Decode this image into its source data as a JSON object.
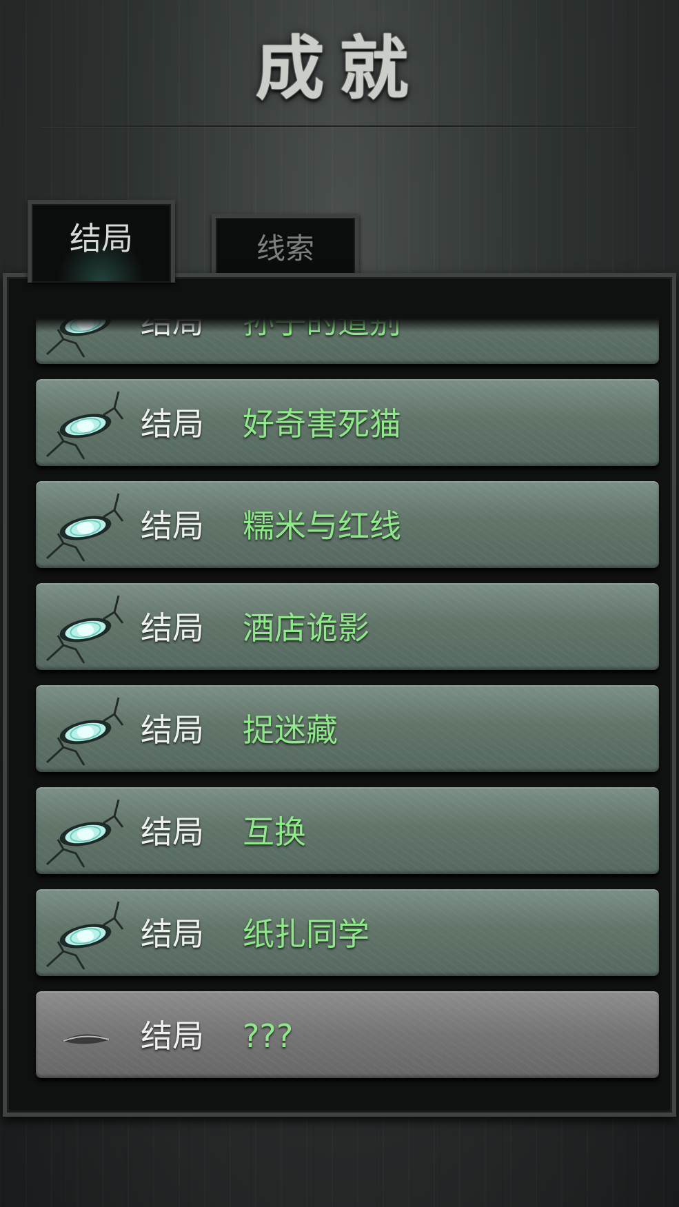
{
  "title": "成就",
  "tabs": [
    {
      "label": "结局",
      "active": true
    },
    {
      "label": "线索",
      "active": false
    }
  ],
  "list": {
    "rows": [
      {
        "label": "结局",
        "name": "孙子的道别",
        "unlocked": true,
        "icon": "cracked-eye-icon"
      },
      {
        "label": "结局",
        "name": "好奇害死猫",
        "unlocked": true,
        "icon": "cracked-eye-icon"
      },
      {
        "label": "结局",
        "name": "糯米与红线",
        "unlocked": true,
        "icon": "cracked-eye-icon"
      },
      {
        "label": "结局",
        "name": "酒店诡影",
        "unlocked": true,
        "icon": "cracked-eye-icon"
      },
      {
        "label": "结局",
        "name": "捉迷藏",
        "unlocked": true,
        "icon": "cracked-eye-icon"
      },
      {
        "label": "结局",
        "name": "互换",
        "unlocked": true,
        "icon": "cracked-eye-icon"
      },
      {
        "label": "结局",
        "name": "纸扎同学",
        "unlocked": true,
        "icon": "cracked-eye-icon"
      },
      {
        "label": "结局",
        "name": "???",
        "unlocked": false,
        "icon": "closed-eye-icon"
      }
    ]
  },
  "colors": {
    "unlocked_name": "#8fe98a",
    "label": "#f0f2ef",
    "row_unlocked": "#617468",
    "row_locked": "#747474"
  }
}
